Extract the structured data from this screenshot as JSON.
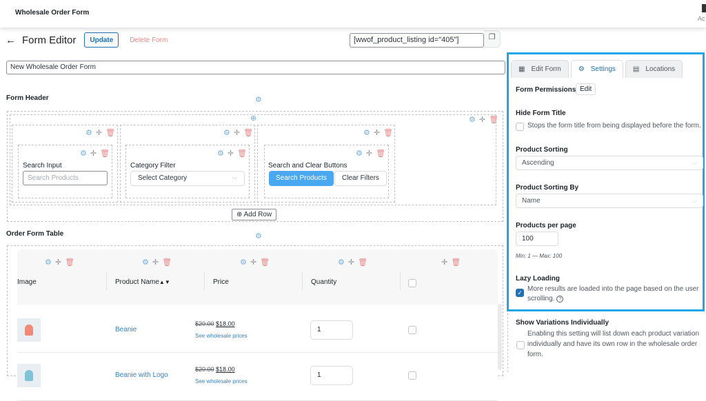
{
  "topbar": {
    "title": "Wholesale Order Form",
    "account_sub": "Ac"
  },
  "editor": {
    "back_icon": "←",
    "title": "Form Editor",
    "update_label": "Update",
    "delete_label": "Delete Form",
    "shortcode": "[wwof_product_listing id=\"405\"]",
    "copy_icon": "❐",
    "form_name": "New Wholesale Order Form"
  },
  "icons": {
    "gear": "⚙",
    "plus": "✛",
    "trash": "🗑",
    "add_circle": "⊕",
    "chevron": "⌵",
    "check": "✓",
    "help": "?"
  },
  "form_header": {
    "label": "Form Header",
    "search_input": {
      "label": "Search Input",
      "placeholder": "Search Products"
    },
    "category_filter": {
      "label": "Category Filter",
      "value": "Select Category"
    },
    "buttons": {
      "label": "Search and Clear Buttons",
      "search": "Search Products",
      "clear": "Clear Filters"
    },
    "add_row": "Add Row"
  },
  "order_table": {
    "label": "Order Form Table",
    "columns": [
      "Image",
      "Product Name",
      "Price",
      "Quantity",
      ""
    ],
    "sort_icons": "▲▼",
    "rows": [
      {
        "name": "Beanie",
        "old_price": "$20.00",
        "new_price": "$18.00",
        "wholesale_link": "See wholesale prices",
        "qty": "1",
        "color": "#f08a78"
      },
      {
        "name": "Beanie with Logo",
        "old_price": "$20.00",
        "new_price": "$18.00",
        "wholesale_link": "See wholesale prices",
        "qty": "1",
        "color": "#7fc3d6"
      }
    ]
  },
  "settings_panel": {
    "tabs": [
      {
        "label": "Edit Form",
        "icon": "▦",
        "active": false
      },
      {
        "label": "Settings",
        "icon": "⚙",
        "active": true
      },
      {
        "label": "Locations",
        "icon": "▤",
        "active": false
      }
    ],
    "form_permissions": {
      "label": "Form Permissions",
      "button": "Edit"
    },
    "hide_form_title": {
      "label": "Hide Form Title",
      "text": "Stops the form title from being displayed before the form.",
      "checked": false
    },
    "product_sorting": {
      "label": "Product Sorting",
      "value": "Ascending"
    },
    "product_sorting_by": {
      "label": "Product Sorting By",
      "value": "Name"
    },
    "products_per_page": {
      "label": "Products per page",
      "value": "100",
      "hint": "Min: 1 — Max: 100"
    },
    "lazy_loading": {
      "label": "Lazy Loading",
      "text_line1": "More results are loaded into the page based on the user",
      "text_line2": "scrolling.",
      "checked": true
    },
    "show_variations": {
      "label": "Show Variations Individually",
      "text_line1": "Enabling this setting will list down each product variation",
      "text_line2": "individually and have its own row in the wholesale order",
      "text_line3": "form.",
      "checked": false
    }
  },
  "colors": {
    "accent": "#1ea7e6",
    "primary_button": "#4aa8f0",
    "link": "#3582c4",
    "danger": "#e58a8a"
  }
}
